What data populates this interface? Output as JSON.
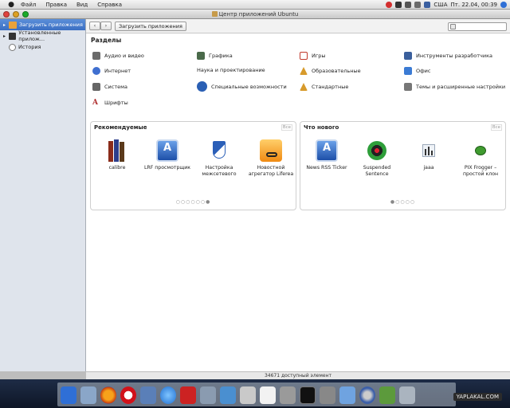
{
  "menubar": {
    "apple": "",
    "items": [
      "Файл",
      "Правка",
      "Вид",
      "Справка"
    ],
    "tray": {
      "locale": "США",
      "clock": "Пт. 22.04, 00:39"
    }
  },
  "window": {
    "title": "Центр приложений Ubuntu"
  },
  "sidebar": {
    "items": [
      {
        "label": "Загрузить приложения",
        "icon": "download-apps-icon",
        "active": true
      },
      {
        "label": "Установленные прилож...",
        "icon": "monitor-icon",
        "active": false
      },
      {
        "label": "История",
        "icon": "history-clock-icon",
        "active": false
      }
    ]
  },
  "toolbar": {
    "back": "‹",
    "forward": "›",
    "breadcrumb": "Загрузить приложения",
    "search_placeholder": ""
  },
  "sections": {
    "title": "Разделы",
    "items": [
      {
        "label": "Аудио и видео",
        "icon": "audio-video-icon",
        "color": "#6b6b6b"
      },
      {
        "label": "Графика",
        "icon": "graphics-icon",
        "color": "#4a6a4a"
      },
      {
        "label": "Игры",
        "icon": "games-icon",
        "color": "#c0392b"
      },
      {
        "label": "Инструменты разработчика",
        "icon": "developer-tools-icon",
        "color": "#3a5f9c"
      },
      {
        "label": "Интернет",
        "icon": "internet-icon",
        "color": "#3f6fd0"
      },
      {
        "label": "Наука и проектирование",
        "icon": "",
        "color": "#ffffff"
      },
      {
        "label": "Образовательные",
        "icon": "education-icon",
        "color": "#d79a2b"
      },
      {
        "label": "Офис",
        "icon": "office-icon",
        "color": "#3b7bd4"
      },
      {
        "label": "Система",
        "icon": "system-icon",
        "color": "#666666"
      },
      {
        "label": "Специальные возможности",
        "icon": "accessibility-icon",
        "color": "#2a5fb4"
      },
      {
        "label": "Стандартные",
        "icon": "accessories-icon",
        "color": "#d79a2b"
      },
      {
        "label": "Темы и расширенные настройки",
        "icon": "themes-icon",
        "color": "#777777"
      },
      {
        "label": "Шрифты",
        "icon": "fonts-icon",
        "color": "#b03030"
      }
    ]
  },
  "featured": {
    "title": "Рекомендуемые",
    "all_label": "Все",
    "apps": [
      {
        "name": "calibre",
        "icon": "books-icon"
      },
      {
        "name": "LRF просмотрщик",
        "icon": "app-store-a-icon"
      },
      {
        "name": "Настройка межсетевого",
        "icon": "shield-icon"
      },
      {
        "name": "Новостной агрегатор Liferea",
        "icon": "rss-icon"
      }
    ],
    "dots": "○○○○○○●"
  },
  "whats_new": {
    "title": "Что нового",
    "all_label": "Все",
    "apps": [
      {
        "name": "News RSS Ticker",
        "icon": "app-store-a-icon"
      },
      {
        "name": "Suspended Sentence",
        "icon": "camera-icon"
      },
      {
        "name": "jaaa",
        "icon": "chart-icon"
      },
      {
        "name": "PIX Frogger – простой клон",
        "icon": "frog-icon"
      }
    ],
    "dots": "●○○○○"
  },
  "status": {
    "text": "34671 доступный элемент"
  },
  "watermark": "YAPLAKAL.COM",
  "dock": {
    "icons": [
      "finder-icon",
      "firefox-icon",
      "opera-icon",
      "people-icon",
      "itunes-icon",
      "ebook-icon",
      "photos-icon",
      "screen-icon",
      "scanner-icon",
      "textedit-icon",
      "calculator-icon",
      "terminal-icon",
      "settings-icon",
      "folder-icon",
      "disc-icon",
      "package-icon",
      "trash-icon"
    ]
  }
}
